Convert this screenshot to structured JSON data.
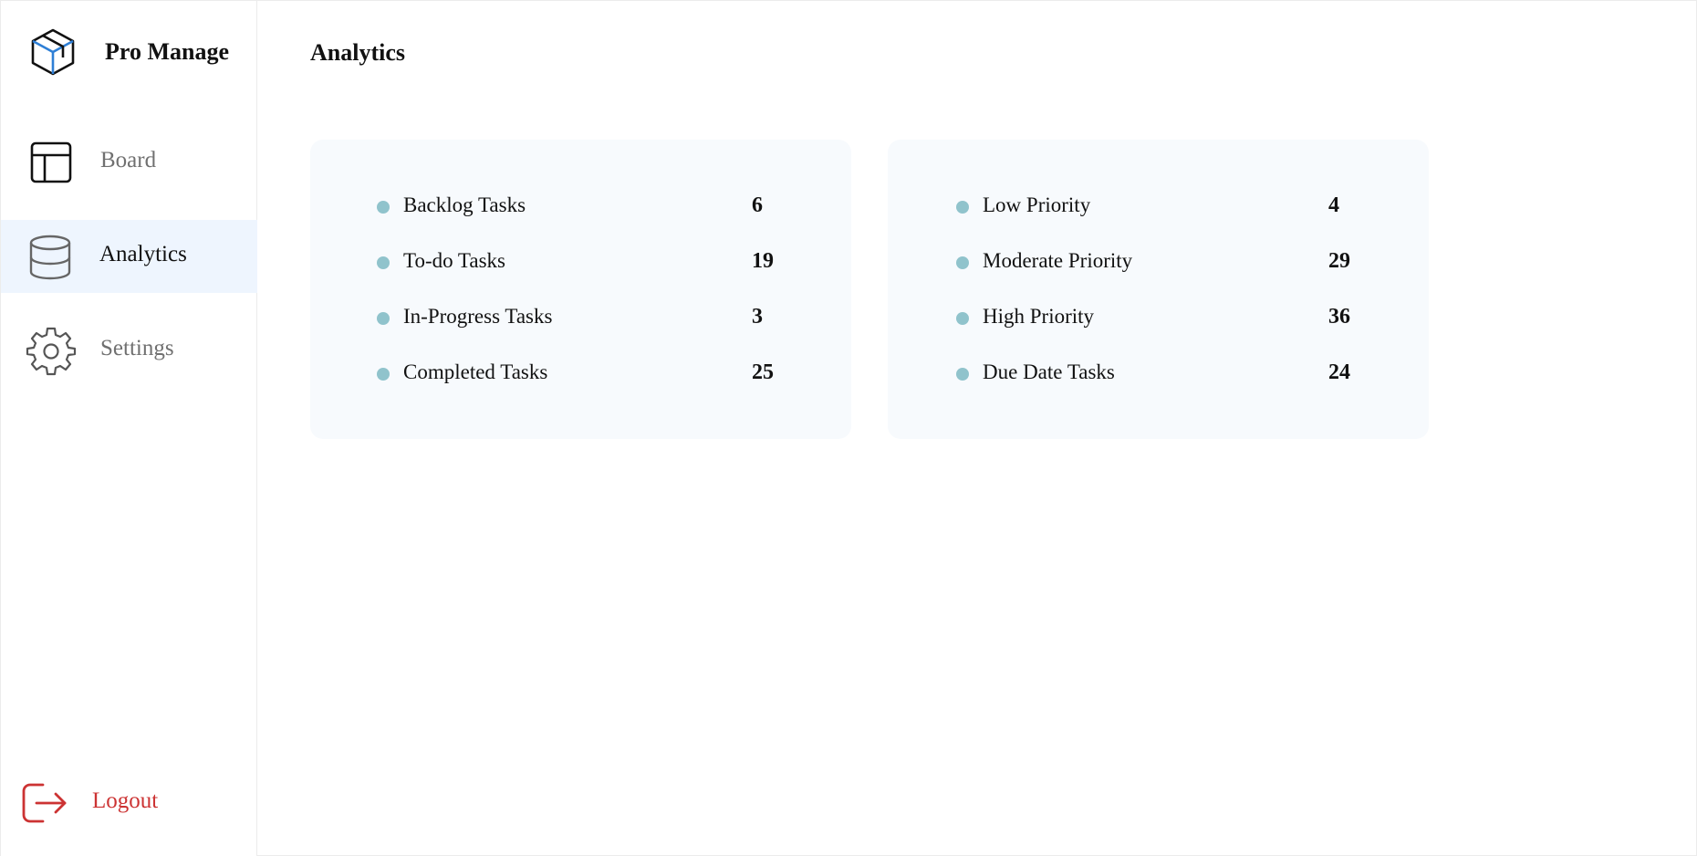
{
  "app": {
    "brand_name": "Pro Manage",
    "logo_icon": "cube-logo-icon"
  },
  "sidebar": {
    "items": [
      {
        "label": "Board",
        "icon": "board-layout-icon",
        "active": false
      },
      {
        "label": "Analytics",
        "icon": "database-icon",
        "active": true
      },
      {
        "label": "Settings",
        "icon": "gear-icon",
        "active": false
      }
    ],
    "logout": {
      "label": "Logout",
      "icon": "logout-icon"
    }
  },
  "main": {
    "title": "Analytics",
    "status_card": {
      "rows": [
        {
          "label": "Backlog Tasks",
          "value": "6"
        },
        {
          "label": "To-do Tasks",
          "value": "19"
        },
        {
          "label": "In-Progress Tasks",
          "value": "3"
        },
        {
          "label": "Completed Tasks",
          "value": "25"
        }
      ]
    },
    "priority_card": {
      "rows": [
        {
          "label": "Low Priority",
          "value": "4"
        },
        {
          "label": "Moderate Priority",
          "value": "29"
        },
        {
          "label": "High Priority",
          "value": "36"
        },
        {
          "label": "Due Date Tasks",
          "value": "24"
        }
      ]
    }
  },
  "colors": {
    "active_nav_bg": "#eef5fe",
    "card_bg": "#f7fafd",
    "bullet": "#90c3cc",
    "logout": "#cc3333",
    "logo_accent": "#2e7fd6"
  }
}
